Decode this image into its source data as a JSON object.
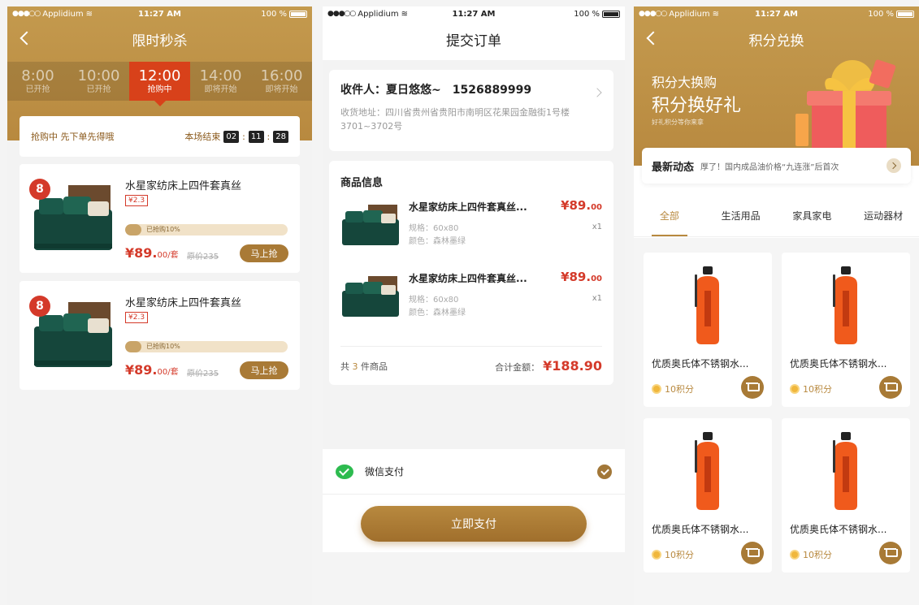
{
  "status": {
    "carrier": "Applidium",
    "time": "11:27 AM",
    "battery": "100 %"
  },
  "flash": {
    "title": "限时秒杀",
    "slots": [
      {
        "time": "8:00",
        "state": "已开抢"
      },
      {
        "time": "10:00",
        "state": "已开抢"
      },
      {
        "time": "12:00",
        "state": "抢购中"
      },
      {
        "time": "14:00",
        "state": "即将开始"
      },
      {
        "time": "16:00",
        "state": "即将开始"
      }
    ],
    "countdown": {
      "left_text": "抢购中 先下单先得哦",
      "right_text": "本场结束",
      "h": "02",
      "m": "11",
      "s": "28"
    },
    "items": [
      {
        "badge": "8",
        "title": "水星家纺床上四件套真丝",
        "tag": "¥2.3",
        "progress_label": "已抢购10%",
        "progress": 0.1,
        "price": "¥89.",
        "price_dec": "00",
        "unit": "/套",
        "old_price": "原价235",
        "button": "马上抢"
      },
      {
        "badge": "8",
        "title": "水星家纺床上四件套真丝",
        "tag": "¥2.3",
        "progress_label": "已抢购10%",
        "progress": 0.1,
        "price": "¥89.",
        "price_dec": "00",
        "unit": "/套",
        "old_price": "原价235",
        "button": "马上抢"
      }
    ]
  },
  "order": {
    "title": "提交订单",
    "receiver_label": "收件人：夏日悠悠~",
    "phone": "1526889999",
    "address": "收货地址：四川省贵州省贵阳市南明区花果园金融街1号楼3701~3702号",
    "goods_title": "商品信息",
    "goods": [
      {
        "name": "水星家纺床上四件套真丝...",
        "price": "¥89.",
        "price_dec": "00",
        "spec": "规格：60x80",
        "color": "颜色：森林墨绿",
        "qty": "x1"
      },
      {
        "name": "水星家纺床上四件套真丝...",
        "price": "¥89.",
        "price_dec": "00",
        "spec": "规格：60x80",
        "color": "颜色：森林墨绿",
        "qty": "x1"
      }
    ],
    "count_prefix": "共 ",
    "count": "3",
    "count_suffix": " 件商品",
    "total_label": "合计金额：",
    "total": "¥188.90",
    "pay_method": "微信支付",
    "pay_button": "立即支付"
  },
  "points": {
    "title": "积分兑换",
    "banner_line1": "积分大换购",
    "banner_line2": "积分换好礼",
    "banner_line3": "好礼积分等你来拿",
    "news_title": "最新动态",
    "news_text": "厚了！国内成品油价格“九连涨”后首次",
    "tabs": [
      "全部",
      "生活用品",
      "家具家电",
      "运动器材"
    ],
    "products": [
      {
        "name": "优质奥氏体不锈钢水...",
        "points": "10积分"
      },
      {
        "name": "优质奥氏体不锈钢水...",
        "points": "10积分"
      },
      {
        "name": "优质奥氏体不锈钢水...",
        "points": "10积分"
      },
      {
        "name": "优质奥氏体不锈钢水...",
        "points": "10积分"
      }
    ]
  },
  "colors": {
    "gold": "#b8893f",
    "red": "#d43a2a",
    "active_slot": "#d8411a"
  }
}
